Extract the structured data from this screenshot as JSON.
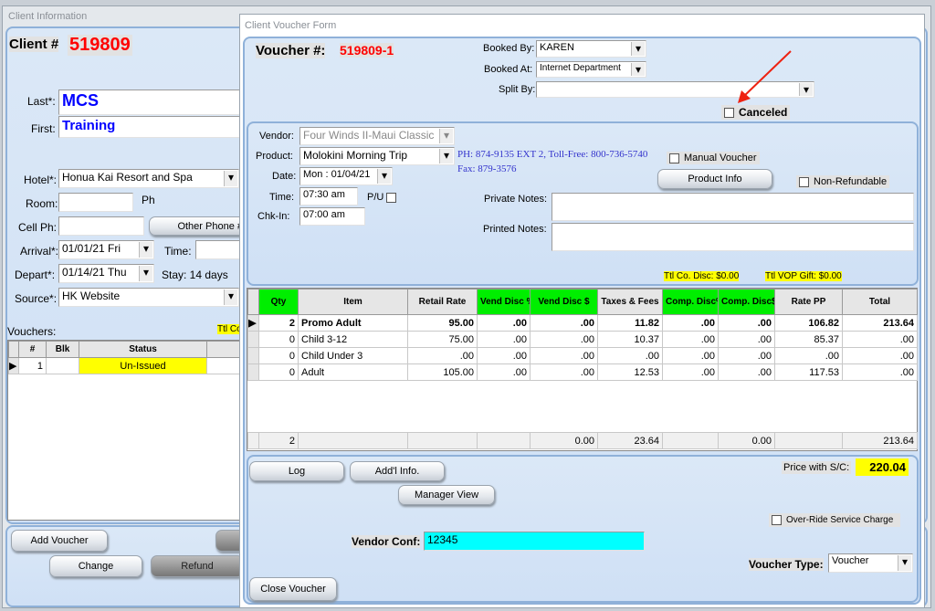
{
  "client_window": {
    "title": "Client Information",
    "client_label": "Client #",
    "client_number": "519809",
    "last_label": "Last*:",
    "last": "MCS",
    "first_label": "First:",
    "first": "Training",
    "hotel_label": "Hotel*:",
    "hotel": "Honua Kai Resort and Spa",
    "room_label": "Room:",
    "room": "",
    "ph_label": "Ph",
    "cell_label": "Cell Ph:",
    "cell": "",
    "other_phone_button": "Other Phone #",
    "arrival_label": "Arrival*:",
    "arrival": "01/01/21 Fri",
    "time_label": "Time:",
    "time": "",
    "depart_label": "Depart*:",
    "depart": "01/14/21 Thu",
    "stay": "Stay: 14 days",
    "source_label": "Source*:",
    "source": "HK Website",
    "vouchers_label": "Vouchers:",
    "ttl_partial": "Ttl Co",
    "vouchers_columns": [
      "#",
      "Blk",
      "Status"
    ],
    "vouchers_rows": [
      {
        "num": "1",
        "blk": "",
        "status": "Un-Issued"
      }
    ],
    "buttons": {
      "add_voucher": "Add Voucher",
      "change": "Change",
      "refund": "Refund"
    }
  },
  "voucher_form": {
    "title": "Client Voucher Form",
    "voucher_label": "Voucher #:",
    "voucher_number": "519809-1",
    "booked_by_label": "Booked By:",
    "booked_by": "KAREN",
    "booked_at_label": "Booked At:",
    "booked_at": "Internet Department",
    "split_by_label": "Split By:",
    "split_by": "",
    "canceled_label": "Canceled",
    "canceled": false,
    "vendor_label": "Vendor:",
    "vendor": "Four Winds II-Maui Classic",
    "product_label": "Product:",
    "product": "Molokini Morning Trip",
    "phone_info": "PH: 874-9135 EXT 2, Toll-Free: 800-736-5740",
    "fax_info": "Fax: 879-3576",
    "manual_voucher_label": "Manual Voucher",
    "product_info_button": "Product Info",
    "non_refundable_label": "Non-Refundable",
    "date_label": "Date:",
    "date": "Mon : 01/04/21",
    "time_label": "Time:",
    "time": "07:30 am",
    "pu_label": "P/U",
    "chkin_label": "Chk-In:",
    "chkin": "07:00 am",
    "private_notes_label": "Private Notes:",
    "private_notes": "",
    "printed_notes_label": "Printed Notes:",
    "printed_notes": "",
    "ttl_co_disc": "Ttl Co. Disc: $0.00",
    "ttl_vop_gift": "Ttl VOP Gift: $0.00",
    "grid": {
      "columns": [
        "Qty",
        "Item",
        "Retail Rate",
        "Vend Disc %",
        "Vend Disc $",
        "Taxes & Fees",
        "Comp. Disc%",
        "Comp. Disc$",
        "Rate PP",
        "Total"
      ],
      "highlight_color": "#00ee00",
      "rows": [
        [
          "2",
          "Promo Adult",
          "95.00",
          ".00",
          ".00",
          "11.82",
          ".00",
          ".00",
          "106.82",
          "213.64"
        ],
        [
          "0",
          "Child 3-12",
          "75.00",
          ".00",
          ".00",
          "10.37",
          ".00",
          ".00",
          "85.37",
          ".00"
        ],
        [
          "0",
          "Child Under 3",
          ".00",
          ".00",
          ".00",
          ".00",
          ".00",
          ".00",
          ".00",
          ".00"
        ],
        [
          "0",
          "Adult",
          "105.00",
          ".00",
          ".00",
          "12.53",
          ".00",
          ".00",
          "117.53",
          ".00"
        ]
      ],
      "totals": {
        "qty": "2",
        "vend_disc": "0.00",
        "taxes": "23.64",
        "comp_disc": "0.00",
        "total": "213.64"
      }
    },
    "log_button": "Log",
    "addl_info_button": "Add'l Info.",
    "manager_view_button": "Manager View",
    "price_sc_label": "Price with S/C:",
    "price_sc": "220.04",
    "override_label": "Over-Ride Service Charge",
    "vendor_conf_label": "Vendor Conf:",
    "vendor_conf": "12345",
    "voucher_type_label": "Voucher Type:",
    "voucher_type": "Voucher",
    "close_button": "Close Voucher"
  }
}
